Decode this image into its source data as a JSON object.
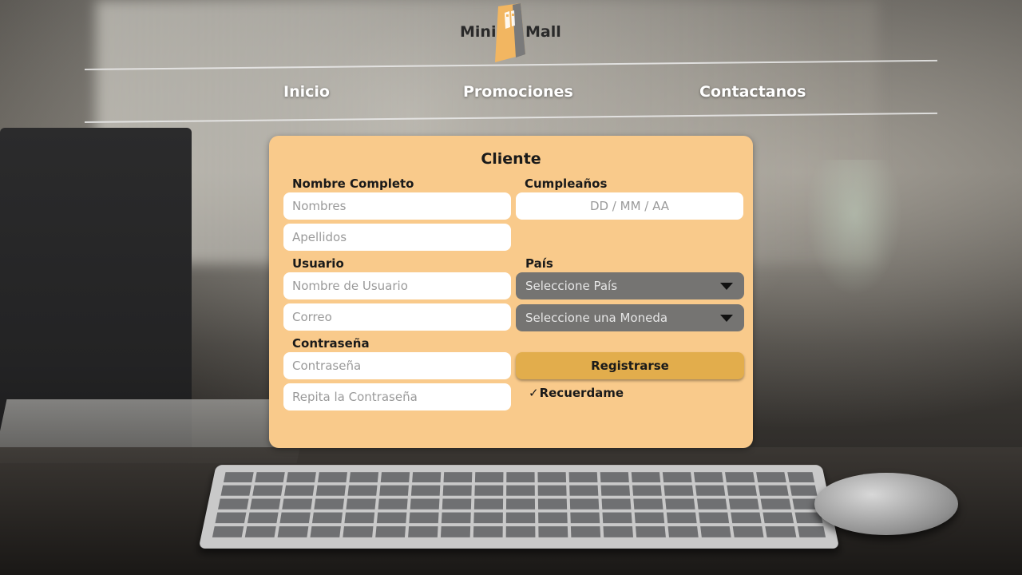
{
  "header": {
    "logo_left": "Mini",
    "logo_right": "Mall",
    "nav": [
      "Inicio",
      "Promociones",
      "Contactanos"
    ]
  },
  "form": {
    "title": "Cliente",
    "labels": {
      "full_name": "Nombre Completo",
      "birthday": "Cumpleaños",
      "user": "Usuario",
      "country": "País",
      "password": "Contraseña"
    },
    "placeholders": {
      "first_name": "Nombres",
      "last_name": "Apellidos",
      "birthday": "DD / MM / AA",
      "username": "Nombre de Usuario",
      "email": "Correo",
      "password": "Contraseña",
      "repeat_password": "Repita la Contraseña"
    },
    "selects": {
      "country": "Seleccione País",
      "currency": "Seleccione una Moneda"
    },
    "register_label": "Registrarse",
    "remember_label": "Recuerdame",
    "remember_checked": true
  },
  "colors": {
    "card_bg": "#f9ca8b",
    "register_bg": "#e2ad4c",
    "select_bg": "#757472",
    "logo_accent": "#f2b661"
  }
}
